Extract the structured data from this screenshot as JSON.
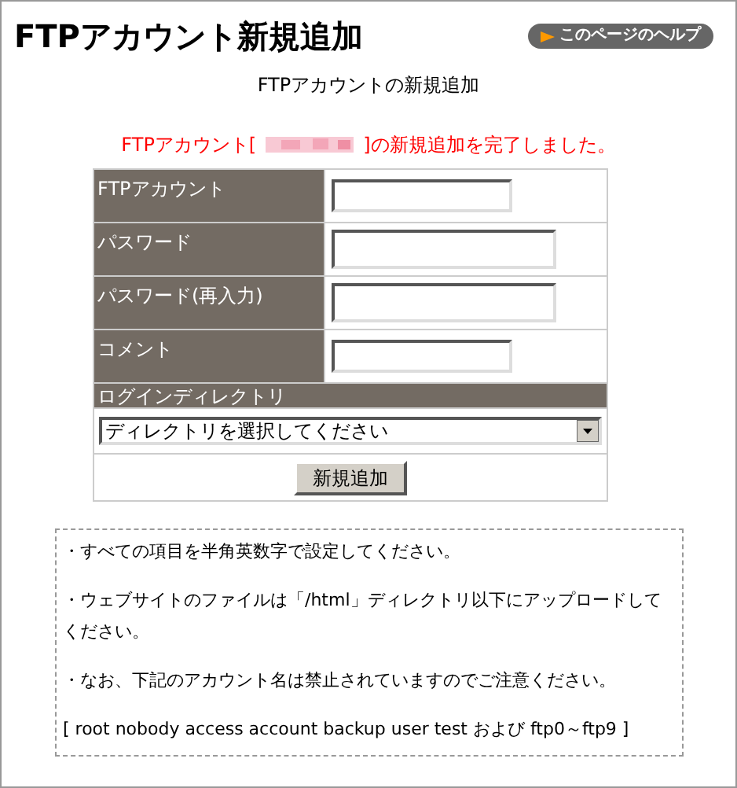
{
  "title": "FTPアカウント新規追加",
  "help_button": {
    "label": "このページのヘルプ"
  },
  "subtitle": "FTPアカウントの新規追加",
  "message": {
    "before": "FTPアカウント[",
    "after": "]の新規追加を完了しました。",
    "redacted": true
  },
  "form": {
    "fields": [
      {
        "label": "FTPアカウント",
        "kind": "short"
      },
      {
        "label": "パスワード",
        "kind": "long"
      },
      {
        "label": "パスワード(再入力)",
        "kind": "long"
      },
      {
        "label": "コメント",
        "kind": "short"
      }
    ],
    "directory": {
      "label": "ログインディレクトリ",
      "value": "ディレクトリを選択してください"
    },
    "submit": "新規追加"
  },
  "notes": [
    "・すべての項目を半角英数字で設定してください。",
    "・ウェブサイトのファイルは「/html」ディレクトリ以下にアップロードしてください。",
    "・なお、下記のアカウント名は禁止されていますのでご注意ください。",
    "[ root nobody access account backup user test および ftp0～ftp9 ]"
  ]
}
